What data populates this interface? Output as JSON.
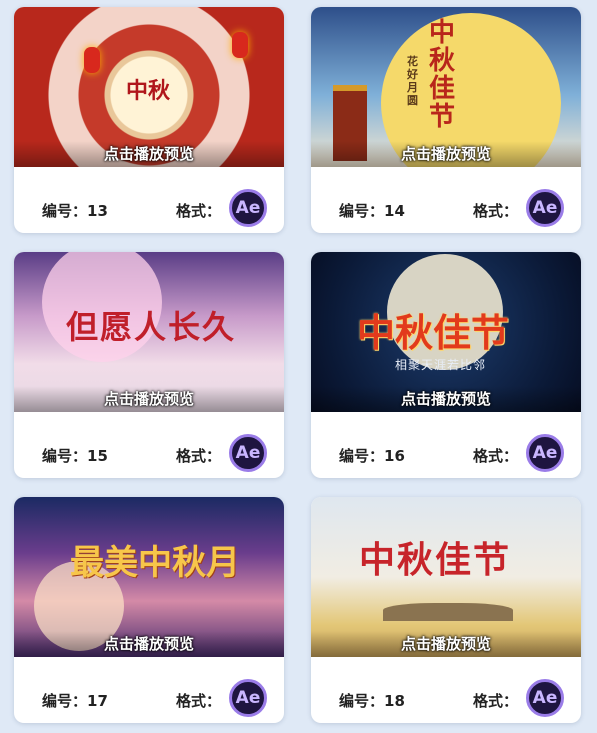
{
  "play_label": "点击播放预览",
  "number_prefix": "编号：",
  "format_label": "格式：",
  "format_badge": "Ae",
  "cards": [
    {
      "number": "13",
      "art_text": "中秋"
    },
    {
      "number": "14",
      "art_text": "中秋佳节",
      "art_sub": "花好月圆"
    },
    {
      "number": "15",
      "art_text": "但愿人长久"
    },
    {
      "number": "16",
      "art_text": "中秋佳节",
      "art_sub": "相聚天涯若比邻"
    },
    {
      "number": "17",
      "art_text": "最美中秋月"
    },
    {
      "number": "18",
      "art_text": "中秋佳节"
    }
  ]
}
